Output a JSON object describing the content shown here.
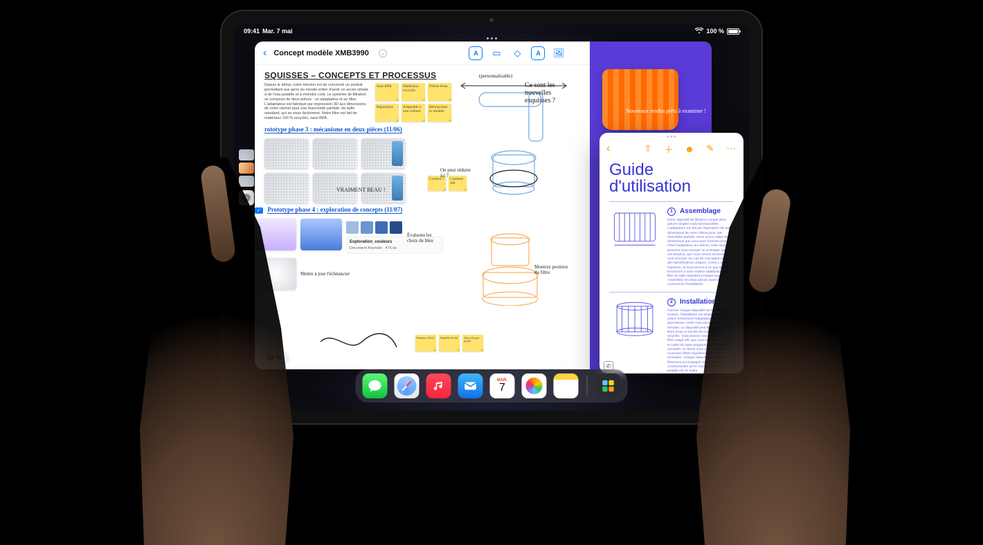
{
  "status": {
    "time": "09:41",
    "date": "Mar. 7 mai",
    "battery": "100 %"
  },
  "mainWindow": {
    "title": "Concept modèle XMB3990",
    "heading": "SQUISSES – CONCEPTS ET PROCESSUS",
    "intro": "Depuis le début, notre mission est de concevoir un produit permettant aux gens du monde entier d'avoir un accès simple à de l'eau potable et à moindre coût. Le système de filtration se compose de deux pièces : un adaptateur et un filtre. L'adaptateur est fabriqué par impression 3D aux dimensions de votre robinet pour une étanchéité parfaite, de taille standard, qui se visse facilement. Notre filtre est fait de matériaux 100 % recyclés, sans BPA.",
    "topStickies": [
      "Sans BPA",
      "Matériaux recyclés",
      "Filtres d'eau",
      "Réparation",
      "Adaptable à tout robinet",
      "Réimprimer le modèle"
    ],
    "personnalisable": "(personnalisable)",
    "phase3": "rototype phase 3 : mécanisme en deux pièces (11/06)",
    "beau": "VRAIMENT BEAU !",
    "rightNote1": "Ce sont les nouvelles esquisses ?",
    "reduceNote": "On peut réduire ici ?",
    "sideSticky1": "Couleur ?",
    "sideSticky2": "Contenir AR",
    "phase4": "Prototype phase 4 : exploration de concepts (11/07)",
    "evaluons": "Évaluons les choix de bleu",
    "fileCardName": "Exploration_couleurs",
    "fileCardMeta": "Document Keynote · 476 ko",
    "mettre": "Mettre à jour l'échéancier",
    "bottomStickies": [
      "Rendus 10/24",
      "Modèle 01/04",
      "Tests d'essai 01/07"
    ],
    "montrez": "Montrez position du filtre",
    "zoom": "63 %",
    "purpleNote": "Nouveaux rendus prêts à examiner !"
  },
  "guide": {
    "title": "Guide d'utilisation",
    "sections": [
      {
        "num": "1",
        "title": "Assemblage",
        "text": "Notre dispositif de filtration compte deux pièces simples mais fonctionnelles. L'adaptateur est fait par impression 3D aux dimensions de votre robinet pour une étanchéité parfaite. Nous avons utilisé les dimensions que vous avez fournies pour créer l'adaptateur au robinet, mais nous pouvons vous envoyer un prototype avec vos besoins, que nous serons heureux de vous envoyer. En cas de conception selon des spécifications uniques, il peut y avoir des imprévus, et nous tenons à ce que le produit fonctionne à votre entière satisfaction. Le filtre de taille standard à l'étape suivante. Assemblez les deux pièces avant de commencer l'installation."
      },
      {
        "num": "2",
        "title": "Installation",
        "text": "Comme chaque dispositif est fabriqué sur mesure, l'installation est simple comme tout : vissez fermement l'adaptateur au robinet, puis laissez couler l'eau pendant trois minutes. Le dispositif peut filtrer environ 400 litres d'eau et est fait de matériaux 100 % recyclés. Vous pouvez nous retourner votre filtre usagé afin que nous le recyclions dans le cadre de notre programme d'utilisation circulaire, et même vous y faire livrer de nouveaux filtres régulièrement, si vous le souhaitez. Chaque dispositif achevé est fièrement accompagné d'une note aux communautés qui le reçoivent, et l'eau potable est un enjeu."
      }
    ]
  },
  "dock": {
    "calMonth": "MAR.",
    "calDay": "7"
  }
}
